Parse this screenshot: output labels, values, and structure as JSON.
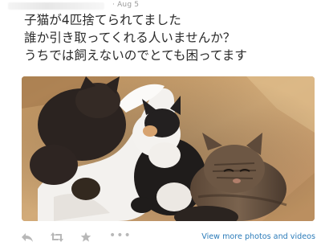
{
  "tweet": {
    "date": "Aug 5",
    "lines": [
      "子猫が4匹捨てられてました",
      "誰か引き取ってくれる人いませんか？",
      "うちでは飼えないのでとても困ってます"
    ],
    "media": {
      "description_icon": "photo-of-kittens-in-box"
    }
  },
  "actions": {
    "reply_icon": "reply-icon",
    "retweet_icon": "retweet-icon",
    "favorite_icon": "star-icon",
    "more_icon": "more-icon",
    "more_glyph": "•••",
    "view_more_label": "View more photos and videos"
  },
  "colors": {
    "text": "#2a2a2a",
    "meta": "#9a9a9a",
    "link": "#2b7bb9",
    "icon": "#b8b8b8"
  }
}
